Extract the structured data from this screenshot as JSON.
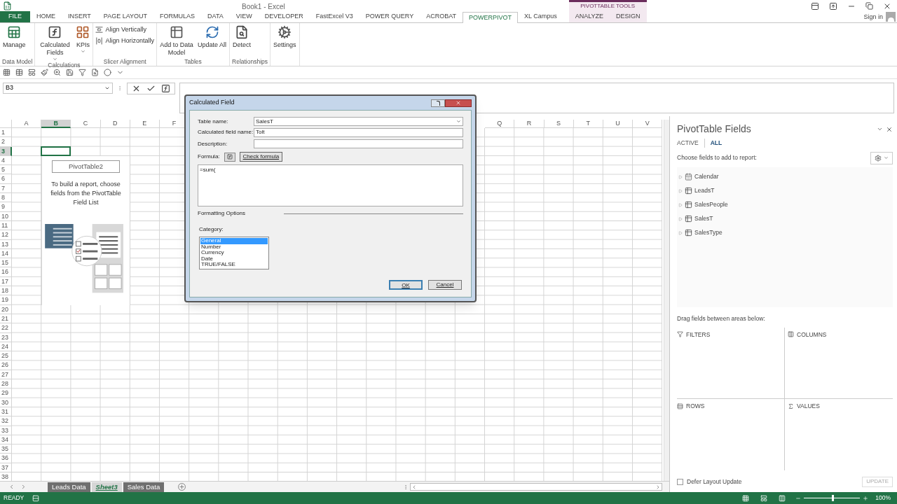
{
  "app": {
    "title": "Book1 - Excel",
    "sign_in": "Sign in"
  },
  "contextual_group": {
    "label": "PIVOTTABLE TOOLS"
  },
  "ribbon_tabs": [
    {
      "label": "FILE",
      "selected": false,
      "kind": "file"
    },
    {
      "label": "HOME",
      "selected": false,
      "kind": "normal"
    },
    {
      "label": "INSERT",
      "selected": false,
      "kind": "normal"
    },
    {
      "label": "PAGE LAYOUT",
      "selected": false,
      "kind": "normal"
    },
    {
      "label": "FORMULAS",
      "selected": false,
      "kind": "normal"
    },
    {
      "label": "DATA",
      "selected": false,
      "kind": "normal"
    },
    {
      "label": "VIEW",
      "selected": false,
      "kind": "normal"
    },
    {
      "label": "DEVELOPER",
      "selected": false,
      "kind": "normal"
    },
    {
      "label": "FastExcel V3",
      "selected": false,
      "kind": "normal"
    },
    {
      "label": "POWER QUERY",
      "selected": false,
      "kind": "normal"
    },
    {
      "label": "ACROBAT",
      "selected": false,
      "kind": "normal"
    },
    {
      "label": "POWERPIVOT",
      "selected": true,
      "kind": "normal"
    },
    {
      "label": "XL Campus",
      "selected": false,
      "kind": "normal"
    },
    {
      "label": "ANALYZE",
      "selected": false,
      "kind": "contextual"
    },
    {
      "label": "DESIGN",
      "selected": false,
      "kind": "contextual"
    }
  ],
  "ribbon_groups": [
    {
      "label": "Data Model",
      "buttons": [
        {
          "label": "Manage",
          "kind": "large",
          "dropdown": false
        }
      ]
    },
    {
      "label": "Calculations",
      "buttons": [
        {
          "label": "Calculated Fields",
          "kind": "large",
          "dropdown": true
        },
        {
          "label": "KPIs",
          "kind": "large",
          "dropdown": true
        }
      ]
    },
    {
      "label": "Slicer Alignment",
      "buttons": [
        {
          "label": "Align Vertically",
          "kind": "small",
          "dropdown": false
        },
        {
          "label": "Align Horizontally",
          "kind": "small",
          "dropdown": false
        }
      ]
    },
    {
      "label": "Tables",
      "buttons": [
        {
          "label": "Add to Data Model",
          "kind": "large",
          "dropdown": false
        },
        {
          "label": "Update All",
          "kind": "large",
          "dropdown": false
        }
      ]
    },
    {
      "label": "Relationships",
      "buttons": [
        {
          "label": "Detect",
          "kind": "large",
          "dropdown": false
        }
      ]
    },
    {
      "buttons": [
        {
          "label": "Settings",
          "kind": "large",
          "dropdown": false
        }
      ]
    }
  ],
  "name_box": {
    "value": "B3"
  },
  "sheet": {
    "columns": [
      {
        "label": "A",
        "selected": false
      },
      {
        "label": "B",
        "selected": true
      },
      {
        "label": "C",
        "selected": false
      },
      {
        "label": "D",
        "selected": false
      },
      {
        "label": "E",
        "selected": false
      },
      {
        "label": "F",
        "selected": false
      },
      {
        "label": "Q",
        "selected": false
      },
      {
        "label": "R",
        "selected": false
      },
      {
        "label": "S",
        "selected": false
      },
      {
        "label": "T",
        "selected": false
      },
      {
        "label": "U",
        "selected": false
      },
      {
        "label": "V",
        "selected": false
      }
    ],
    "rows": [
      {
        "label": "1",
        "selected": false
      },
      {
        "label": "2",
        "selected": false
      },
      {
        "label": "3",
        "selected": true
      },
      {
        "label": "4",
        "selected": false
      },
      {
        "label": "5",
        "selected": false
      },
      {
        "label": "6",
        "selected": false
      },
      {
        "label": "7",
        "selected": false
      },
      {
        "label": "8",
        "selected": false
      },
      {
        "label": "9",
        "selected": false
      },
      {
        "label": "10",
        "selected": false
      },
      {
        "label": "11",
        "selected": false
      },
      {
        "label": "12",
        "selected": false
      },
      {
        "label": "13",
        "selected": false
      },
      {
        "label": "14",
        "selected": false
      },
      {
        "label": "15",
        "selected": false
      },
      {
        "label": "16",
        "selected": false
      },
      {
        "label": "17",
        "selected": false
      },
      {
        "label": "18",
        "selected": false
      },
      {
        "label": "19",
        "selected": false
      },
      {
        "label": "20",
        "selected": false
      },
      {
        "label": "21",
        "selected": false
      },
      {
        "label": "22",
        "selected": false
      },
      {
        "label": "23",
        "selected": false
      },
      {
        "label": "24",
        "selected": false
      },
      {
        "label": "25",
        "selected": false
      },
      {
        "label": "26",
        "selected": false
      },
      {
        "label": "27",
        "selected": false
      },
      {
        "label": "28",
        "selected": false
      },
      {
        "label": "29",
        "selected": false
      },
      {
        "label": "30",
        "selected": false
      },
      {
        "label": "31",
        "selected": false
      },
      {
        "label": "32",
        "selected": false
      },
      {
        "label": "33",
        "selected": false
      },
      {
        "label": "34",
        "selected": false
      },
      {
        "label": "35",
        "selected": false
      },
      {
        "label": "36",
        "selected": false
      },
      {
        "label": "37",
        "selected": false
      },
      {
        "label": "38",
        "selected": false
      }
    ]
  },
  "pivot_placeholder": {
    "title": "PivotTable2",
    "message": "To build a report, choose fields from the PivotTable Field List"
  },
  "sheet_tabs": [
    {
      "label": "Leads Data",
      "selected": false
    },
    {
      "label": "Sheet3",
      "selected": true
    },
    {
      "label": "Sales Data",
      "selected": false
    }
  ],
  "dialog": {
    "title": "Calculated Field",
    "table_name": {
      "label": "Table name:",
      "value": "SalesT"
    },
    "field_name": {
      "label": "Calculated field name:",
      "value": "Tolt"
    },
    "description": {
      "label": "Description:"
    },
    "formula": {
      "label": "Formula:",
      "check_button": "Check formula",
      "value": "=sum("
    },
    "formatting": {
      "heading": "Formatting Options",
      "category_label": "Category:",
      "categories": [
        {
          "label": "General",
          "selected": true
        },
        {
          "label": "Number",
          "selected": false
        },
        {
          "label": "Currency",
          "selected": false
        },
        {
          "label": "Date",
          "selected": false
        },
        {
          "label": "TRUE/FALSE",
          "selected": false
        }
      ]
    },
    "buttons": [
      {
        "label": "OK",
        "kind": "default"
      },
      {
        "label": "Cancel",
        "kind": "normal"
      }
    ]
  },
  "pivot_fields": {
    "title": "PivotTable Fields",
    "tabs": [
      {
        "label": "ACTIVE",
        "selected": false
      },
      {
        "label": "ALL",
        "selected": true
      }
    ],
    "prompt": "Choose fields to add to report:",
    "fields": [
      {
        "label": "Calendar",
        "kind": "date_table",
        "expanded": false
      },
      {
        "label": "LeadsT",
        "kind": "table",
        "expanded": false
      },
      {
        "label": "SalesPeople",
        "kind": "table",
        "expanded": false
      },
      {
        "label": "SalesT",
        "kind": "table",
        "expanded": false
      },
      {
        "label": "SalesType",
        "kind": "table",
        "expanded": false
      }
    ],
    "areas_prompt": "Drag fields between areas below:",
    "areas": [
      {
        "label": "FILTERS",
        "kind": "filters"
      },
      {
        "label": "COLUMNS",
        "kind": "columns"
      },
      {
        "label": "ROWS",
        "kind": "rows"
      },
      {
        "label": "VALUES",
        "kind": "values"
      }
    ],
    "defer": {
      "label": "Defer Layout Update",
      "checked": false
    },
    "update_button": {
      "label": "UPDATE",
      "disabled": true
    }
  },
  "status_bar": {
    "mode": "READY",
    "zoom": "100%",
    "zoom_slider": {
      "level": 0.5
    }
  }
}
